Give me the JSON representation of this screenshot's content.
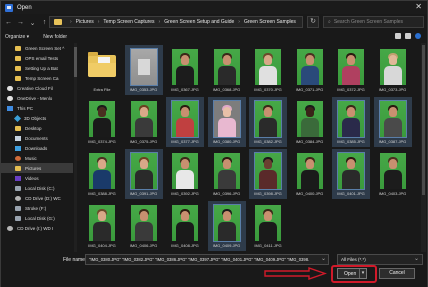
{
  "window": {
    "title": "Open"
  },
  "nav": {
    "back": "←",
    "forward": "→",
    "recent": "⌄",
    "up": "↑"
  },
  "breadcrumb": [
    "Pictures",
    "Temp Screen Captures",
    "Green Screen Setup and Guide",
    "Green Screen Samples"
  ],
  "search": {
    "placeholder": "Search Green Screen Samples"
  },
  "toolbar": {
    "organize": "Organize ▾",
    "new_folder": "New folder"
  },
  "sidebar": {
    "items": [
      {
        "label": "Green Screen Set ^",
        "icon": "folder-icon"
      },
      {
        "label": "OPS email Tests",
        "icon": "folder-icon"
      },
      {
        "label": "Setting Up a Bat",
        "icon": "folder-icon"
      },
      {
        "label": "Temp Screen Ca",
        "icon": "folder-icon"
      },
      {
        "label": "Creative Cloud Fil",
        "icon": "cloud-icon"
      },
      {
        "label": "OneDrive - Menlo",
        "icon": "cloud-icon"
      },
      {
        "label": "This PC",
        "icon": "pc-icon"
      },
      {
        "label": "3D Objects",
        "icon": "cube-icon"
      },
      {
        "label": "Desktop",
        "icon": "folder-icon"
      },
      {
        "label": "Documents",
        "icon": "docs-icon"
      },
      {
        "label": "Downloads",
        "icon": "download-icon"
      },
      {
        "label": "Music",
        "icon": "music-icon"
      },
      {
        "label": "Pictures",
        "icon": "pictures-icon"
      },
      {
        "label": "Videos",
        "icon": "video-icon"
      },
      {
        "label": "Local Disk (C:)",
        "icon": "drive-icon"
      },
      {
        "label": "CD Drive (D:) WC",
        "icon": "cd-icon"
      },
      {
        "label": "Stroke (F:)",
        "icon": "drive-icon"
      },
      {
        "label": "Local Disk (G:)",
        "icon": "drive-icon"
      },
      {
        "label": "CD Drive (I:) WD I",
        "icon": "cd-icon"
      }
    ]
  },
  "files": [
    {
      "name": "Extra File",
      "kind": "folder"
    },
    {
      "name": "IMG_0353.JPG",
      "kind": "gray"
    },
    {
      "name": "IMG_0367.JPG",
      "kind": "photo",
      "hair": "#3a2818",
      "shirt": "#1c1c1c",
      "skin": "#c89070"
    },
    {
      "name": "IMG_0368.JPG",
      "kind": "photo",
      "hair": "#3a2818",
      "shirt": "#2a2a2a",
      "skin": "#c89070"
    },
    {
      "name": "IMG_0370.JPG",
      "kind": "photo",
      "hair": "#6a4a2a",
      "shirt": "#e0e0e0",
      "skin": "#d8a888"
    },
    {
      "name": "IMG_0371.JPG",
      "kind": "photo",
      "hair": "#4a3020",
      "shirt": "#2a4a7a",
      "skin": "#c89070"
    },
    {
      "name": "IMG_0372.JPG",
      "kind": "photo",
      "hair": "#2a1a10",
      "shirt": "#b04060",
      "skin": "#c89070"
    },
    {
      "name": "IMG_0373.JPG",
      "kind": "photo",
      "hair": "#c0a070",
      "shirt": "#d8d8d8",
      "skin": "#e0b898"
    },
    {
      "name": "IMG_0374.JPG",
      "kind": "photo",
      "hair": "#1a1a1a",
      "shirt": "#1a1a1a",
      "skin": "#4a2e20"
    },
    {
      "name": "IMG_0375.JPG",
      "kind": "photo",
      "hair": "#6a4020",
      "shirt": "#3a3a3a",
      "skin": "#d8a888"
    },
    {
      "name": "IMG_0377.JPG",
      "kind": "photo",
      "hair": "#2a1a10",
      "shirt": "#c04040",
      "skin": "#c89070"
    },
    {
      "name": "IMG_0380.JPG",
      "kind": "gray2",
      "hair": "#e0a8c8",
      "shirt": "#e8b8d0",
      "skin": "#e8c0a8"
    },
    {
      "name": "IMG_0382.JPG",
      "kind": "photo",
      "hair": "#3a2818",
      "shirt": "#2a2a2a",
      "skin": "#c89070"
    },
    {
      "name": "IMG_0384.JPG",
      "kind": "photo",
      "hair": "#1a1a1a",
      "shirt": "#3a6a3a",
      "skin": "#3a2418"
    },
    {
      "name": "IMG_0385.JPG",
      "kind": "photo",
      "hair": "#3a2818",
      "shirt": "#2a2a4a",
      "skin": "#c89070"
    },
    {
      "name": "IMG_0387.JPG",
      "kind": "photo",
      "hair": "#2a1a10",
      "shirt": "#4a4a4a",
      "skin": "#c89070"
    },
    {
      "name": "IMG_0388.JPG",
      "kind": "photo",
      "hair": "#4a3020",
      "shirt": "#1a3a6a",
      "skin": "#d8a888"
    },
    {
      "name": "IMG_0391.JPG",
      "kind": "photo",
      "hair": "#6a4020",
      "shirt": "#2a2a2a",
      "skin": "#d8a888"
    },
    {
      "name": "IMG_0392.JPG",
      "kind": "photo",
      "hair": "#3a2818",
      "shirt": "#e8e8e8",
      "skin": "#c89070"
    },
    {
      "name": "IMG_0396.JPG",
      "kind": "photo",
      "hair": "#2a1a10",
      "shirt": "#3a3a3a",
      "skin": "#c89070"
    },
    {
      "name": "IMG_0398.JPG",
      "kind": "photo",
      "hair": "#1a1a1a",
      "shirt": "#5a2a2a",
      "skin": "#6a4030"
    },
    {
      "name": "IMG_0400.JPG",
      "kind": "photo",
      "hair": "#3a2818",
      "shirt": "#1a1a1a",
      "skin": "#c89070"
    },
    {
      "name": "IMG_0401.JPG",
      "kind": "photo",
      "hair": "#2a1a10",
      "shirt": "#2a2a2a",
      "skin": "#c89070"
    },
    {
      "name": "IMG_0403.JPG",
      "kind": "photo",
      "hair": "#4a3020",
      "shirt": "#1c1c1c",
      "skin": "#c89070"
    },
    {
      "name": "IMG_0404.JPG",
      "kind": "photo",
      "hair": "#6a4a2a",
      "shirt": "#2a2a2a",
      "skin": "#d8a888"
    },
    {
      "name": "IMG_0406.JPG",
      "kind": "photo",
      "hair": "#3a2818",
      "shirt": "#3a3a3a",
      "skin": "#c89070"
    },
    {
      "name": "IMG_0408.JPG",
      "kind": "photo",
      "hair": "#2a1a10",
      "shirt": "#1a1a1a",
      "skin": "#c89070"
    },
    {
      "name": "IMG_0409.JPG",
      "kind": "photo",
      "hair": "#1a1a1a",
      "shirt": "#2a2a2a",
      "skin": "#c89070"
    },
    {
      "name": "IMG_0411.JPG",
      "kind": "photo",
      "hair": "#3a2818",
      "shirt": "#1a1a1a",
      "skin": "#c89070"
    }
  ],
  "bottom": {
    "file_name_label": "File name:",
    "file_name_value": "\"IMG_0380.JPG\" \"IMG_0382.JPG\" \"IMG_0386.JPG\" \"IMG_0397.JPG\" \"IMG_0401.JPG\" \"IMG_0409.JPG\" \"IMG_0398.",
    "file_type": "All Files (*.*)",
    "open_label": "Open",
    "cancel_label": "Cancel"
  },
  "colors": {
    "highlight": "#d11a2a",
    "folder": "#e8c35a",
    "green_screen": "#3f9f41"
  }
}
